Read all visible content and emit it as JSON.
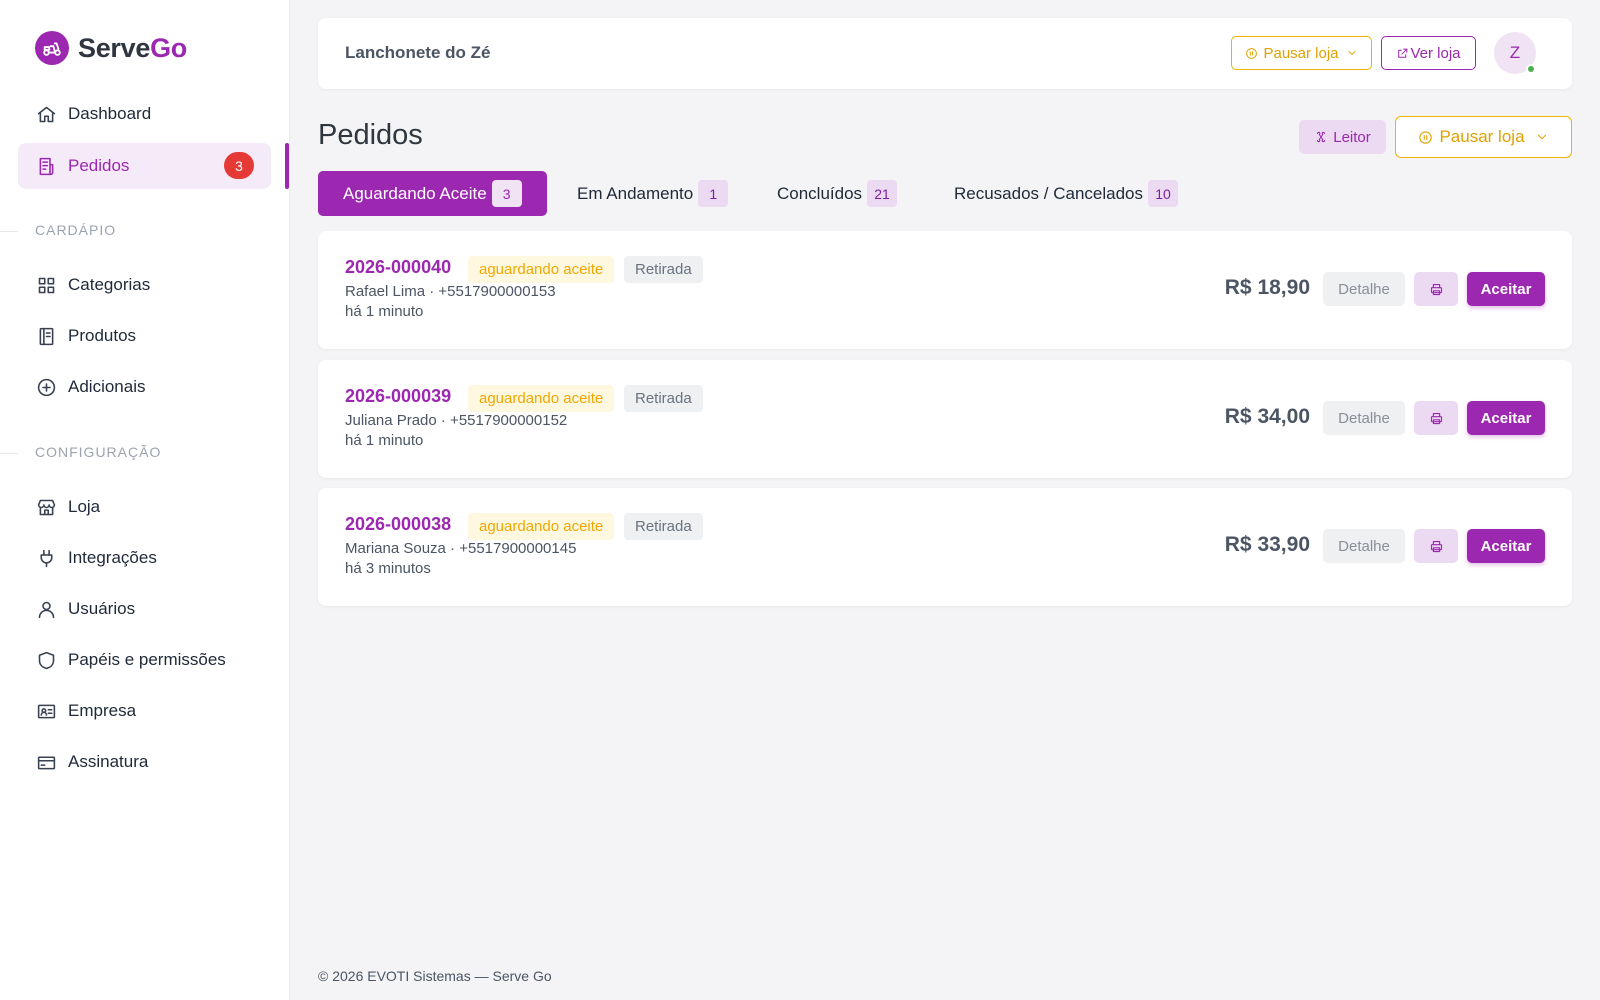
{
  "brand": {
    "name_a": "Serve",
    "name_b": "Go"
  },
  "sidebar": {
    "items": [
      {
        "label": "Dashboard"
      },
      {
        "label": "Pedidos",
        "badge": "3"
      },
      {
        "label": "Categorias"
      },
      {
        "label": "Produtos"
      },
      {
        "label": "Adicionais"
      },
      {
        "label": "Loja"
      },
      {
        "label": "Integrações"
      },
      {
        "label": "Usuários"
      },
      {
        "label": "Papéis e permissões"
      },
      {
        "label": "Empresa"
      },
      {
        "label": "Assinatura"
      }
    ],
    "sections": {
      "cardapio": "CARDÁPIO",
      "configuracao": "CONFIGURAÇÃO"
    }
  },
  "topbar": {
    "store_name": "Lanchonete do Zé",
    "pause_label": "Pausar loja",
    "view_store_label": "Ver loja",
    "avatar_initial": "Z"
  },
  "page": {
    "title": "Pedidos",
    "reader_label": "Leitor",
    "pause_label": "Pausar loja"
  },
  "tabs": [
    {
      "label": "Aguardando Aceite",
      "count": "3"
    },
    {
      "label": "Em Andamento",
      "count": "1"
    },
    {
      "label": "Concluídos",
      "count": "21"
    },
    {
      "label": "Recusados / Cancelados",
      "count": "10"
    }
  ],
  "orders": [
    {
      "id": "2026-000040",
      "status": "aguardando aceite",
      "type": "Retirada",
      "customer": "Rafael Lima · +5517900000153",
      "time": "há 1 minuto",
      "price": "R$ 18,90"
    },
    {
      "id": "2026-000039",
      "status": "aguardando aceite",
      "type": "Retirada",
      "customer": "Juliana Prado · +5517900000152",
      "time": "há 1 minuto",
      "price": "R$ 34,00"
    },
    {
      "id": "2026-000038",
      "status": "aguardando aceite",
      "type": "Retirada",
      "customer": "Mariana Souza · +5517900000145",
      "time": "há 3 minutos",
      "price": "R$ 33,90"
    }
  ],
  "order_actions": {
    "detail_label": "Detalhe",
    "accept_label": "Aceitar"
  },
  "footer": {
    "text": "© 2026 EVOTI Sistemas — Serve Go"
  },
  "colors": {
    "brand": "#9c27b0",
    "warning": "#f0b400",
    "badge": "#e53935",
    "online": "#4caf50"
  }
}
